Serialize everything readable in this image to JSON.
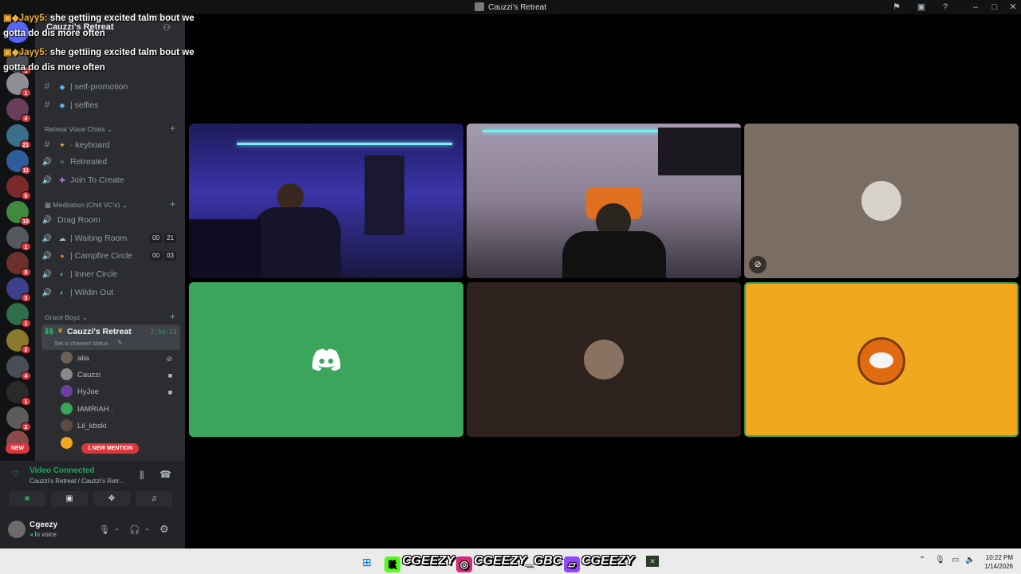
{
  "window": {
    "title": "Cauzzi's Retreat",
    "colors": {
      "titlebar": "#111214",
      "sidebar": "#2b2d31",
      "rail": "#111214",
      "accent_green": "#23a55a",
      "alert_red": "#da373c",
      "background": "#000000"
    }
  },
  "chat_overlay": {
    "messages": [
      {
        "name": "Jayy5:",
        "text": "she gettiing excited talm bout we",
        "text2": "gotta do dis more often"
      },
      {
        "name": "Jayy5:",
        "text": "she gettiing excited talm bout we",
        "text2": "gotta do dis more often"
      }
    ]
  },
  "server_rail": {
    "badges": [
      "1",
      "4",
      "21",
      "11",
      "6",
      "10",
      "1",
      "8",
      "3",
      "1",
      "2",
      "4",
      "1",
      "2"
    ],
    "new_label": "NEW"
  },
  "sidebar": {
    "server_name": "Cauzzi's Retreat",
    "text_channels": [
      {
        "name": "| self-promotion",
        "icon": "hash-icon"
      },
      {
        "name": "| selfies",
        "icon": "hash-icon"
      }
    ],
    "category_voice": "Retreat Voice Chats",
    "voice_channels_1": [
      {
        "name": "· keyboard",
        "icon": "hash-icon"
      },
      {
        "name": "Retreated",
        "icon": "speaker-icon"
      },
      {
        "name": "Join To Create",
        "icon": "speaker-icon"
      }
    ],
    "category_meditation": "Meditation (Chill VC's)",
    "voice_channels_2": [
      {
        "name": "Drag Room",
        "icon": "speaker-icon",
        "a": "",
        "b": ""
      },
      {
        "name": "| Waiting Room",
        "icon": "speaker-icon",
        "a": "00",
        "b": "21"
      },
      {
        "name": "| Campfire Circle",
        "icon": "speaker-icon",
        "a": "00",
        "b": "03"
      },
      {
        "name": "| Inner Circle",
        "icon": "speaker-icon",
        "a": "",
        "b": ""
      },
      {
        "name": "| Wildin Out",
        "icon": "speaker-icon",
        "a": "",
        "b": ""
      }
    ],
    "category_grace": "Grace Boyz",
    "active_channel": {
      "name": "Cauzzi's Retreat",
      "timer": "2:54:21",
      "status": "Set a channel status"
    },
    "members": [
      {
        "name": "alia",
        "indicator": "muted",
        "color": "#6b5f57"
      },
      {
        "name": "Cauzzi",
        "indicator": "video",
        "color": "#8a8a8a"
      },
      {
        "name": "HyJoe",
        "indicator": "video",
        "color": "#6b3fa0"
      },
      {
        "name": "IAMRIAH .",
        "indicator": "",
        "color": "#3ba55c"
      },
      {
        "name": "Lil_kbski",
        "indicator": "",
        "color": "#5c4b45"
      }
    ],
    "mention_pill": "1 NEW MENTION"
  },
  "voice_panel": {
    "status": "Video Connected",
    "location": "Cauzzi's Retreat / Cauzzi's Retr...",
    "user_name": "Cgeezy",
    "user_status": "In voice"
  },
  "video_tiles": [
    {
      "type": "video",
      "bg": "#2a2670"
    },
    {
      "type": "video",
      "bg": "#8c8290"
    },
    {
      "type": "avatar",
      "bg": "#7a6e64",
      "muted": true
    },
    {
      "type": "discord-logo",
      "bg": "#3ba55c"
    },
    {
      "type": "avatar",
      "bg": "#2d221e"
    },
    {
      "type": "avatar",
      "bg": "#f0a81f",
      "speaking": true
    }
  ],
  "taskbar": {
    "handles": [
      "CGEEZY",
      "CGEEZY_GBC",
      "CGEEZY"
    ],
    "time": "10:22 PM",
    "date": "1/14/2026"
  }
}
